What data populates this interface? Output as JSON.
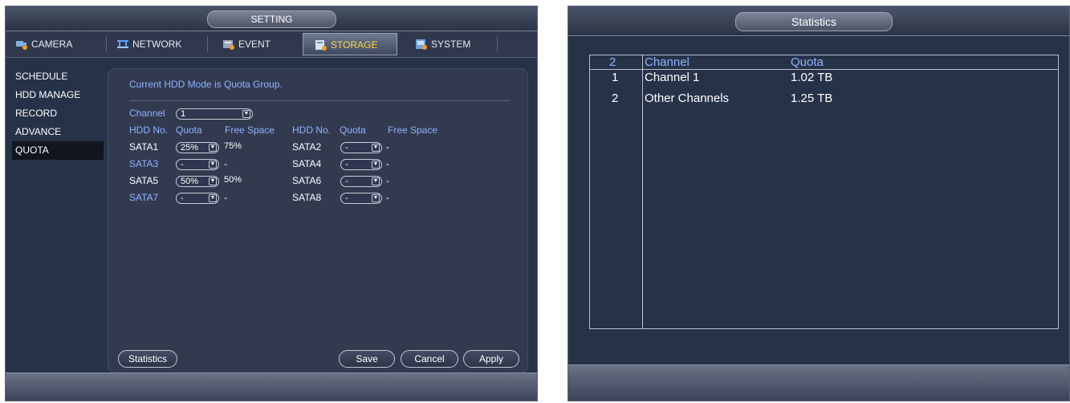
{
  "setting_window": {
    "title": "SETTING",
    "tabs": [
      {
        "label": "CAMERA",
        "icon": "camera-icon"
      },
      {
        "label": "NETWORK",
        "icon": "network-icon"
      },
      {
        "label": "EVENT",
        "icon": "event-icon"
      },
      {
        "label": "STORAGE",
        "icon": "storage-icon",
        "active": true
      },
      {
        "label": "SYSTEM",
        "icon": "system-icon"
      }
    ],
    "menu": [
      "SCHEDULE",
      "HDD MANAGE",
      "RECORD",
      "ADVANCE",
      "QUOTA"
    ],
    "active_menu": "QUOTA",
    "mode_text": "Current HDD Mode is Quota Group.",
    "channel_label": "Channel",
    "channel_value": "1",
    "headers": {
      "hdd_no": "HDD No.",
      "quota": "Quota",
      "free_space": "Free Space"
    },
    "rows": [
      {
        "left": {
          "hdd": "SATA1",
          "quota": "25%",
          "free": "75%"
        },
        "right": {
          "hdd": "SATA2",
          "quota": "-",
          "free": "-"
        }
      },
      {
        "left": {
          "hdd": "SATA3",
          "quota": "-",
          "free": "-"
        },
        "right": {
          "hdd": "SATA4",
          "quota": "-",
          "free": "-"
        }
      },
      {
        "left": {
          "hdd": "SATA5",
          "quota": "50%",
          "free": "50%"
        },
        "right": {
          "hdd": "SATA6",
          "quota": "-",
          "free": "-"
        }
      },
      {
        "left": {
          "hdd": "SATA7",
          "quota": "-",
          "free": "-"
        },
        "right": {
          "hdd": "SATA8",
          "quota": "-",
          "free": "-"
        }
      }
    ],
    "buttons": {
      "statistics": "Statistics",
      "save": "Save",
      "cancel": "Cancel",
      "apply": "Apply"
    },
    "colors": {
      "label_blue": "#8fb3ff",
      "active_tab_text": "#ffd54a",
      "panel_bg": "#323a50"
    }
  },
  "statistics_window": {
    "title": "Statistics",
    "header": {
      "count": "2",
      "channel": "Channel",
      "quota": "Quota"
    },
    "rows": [
      {
        "index": "1",
        "channel": "Channel 1",
        "quota": "1.02 TB"
      },
      {
        "index": "2",
        "channel": "Other Channels",
        "quota": "1.25 TB"
      }
    ]
  }
}
